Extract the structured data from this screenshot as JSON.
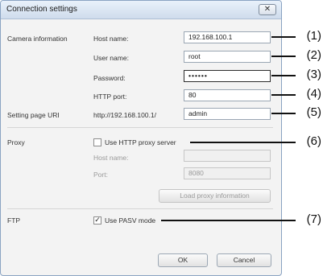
{
  "dialog": {
    "title": "Connection settings",
    "close_glyph": "✕"
  },
  "camera": {
    "section_label": "Camera information",
    "host_label": "Host name:",
    "host_value": "192.168.100.1",
    "user_label": "User name:",
    "user_value": "root",
    "password_label": "Password:",
    "password_value": "••••••",
    "port_label": "HTTP port:",
    "port_value": "80"
  },
  "setting_page": {
    "label": "Setting page URI",
    "prefix": "http://192.168.100.1/",
    "value": "admin"
  },
  "proxy": {
    "section_label": "Proxy",
    "checkbox_label": "Use HTTP proxy server",
    "checked": false,
    "host_label": "Host name:",
    "host_value": "",
    "port_label": "Port:",
    "port_value": "8080",
    "load_button": "Load proxy information"
  },
  "ftp": {
    "section_label": "FTP",
    "checkbox_label": "Use PASV mode",
    "checked": true,
    "check_glyph": "✓"
  },
  "buttons": {
    "ok": "OK",
    "cancel": "Cancel"
  },
  "callouts": [
    "(1)",
    "(2)",
    "(3)",
    "(4)",
    "(5)",
    "(6)",
    "(7)"
  ]
}
